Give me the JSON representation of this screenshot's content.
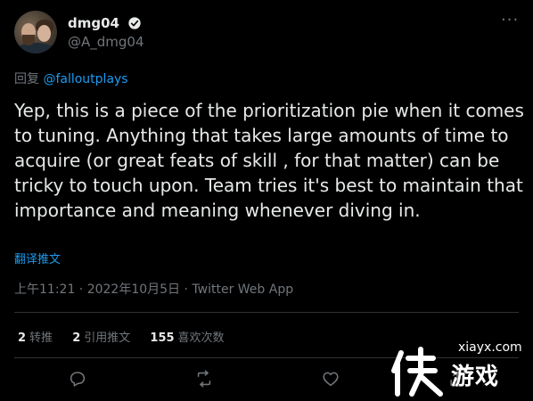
{
  "author": {
    "display_name": "dmg04",
    "handle": "@A_dmg04"
  },
  "more_glyph": "···",
  "reply": {
    "prefix": "回复 ",
    "mention": "@falloutplays"
  },
  "tweet": {
    "text": "Yep, this is a piece of the prioritization pie when it comes to tuning. Anything that takes large amounts of time to acquire (or great feats of skill , for that matter) can be tricky to touch upon. Team tries it's best to maintain that importance and meaning whenever diving in.",
    "translate_label": "翻译推文",
    "meta": "上午11:21 · 2022年10月5日 · Twitter Web App"
  },
  "stats": {
    "retweets_count": "2",
    "retweets_label": "转推",
    "quotes_count": "2",
    "quotes_label": "引用推文",
    "likes_count": "155",
    "likes_label": "喜欢次数"
  },
  "actions": [
    "reply-icon",
    "retweet-icon",
    "like-icon",
    "share-icon"
  ],
  "watermark": {
    "site": "xiayx.com",
    "text": "游戏"
  },
  "colors": {
    "background": "#000000",
    "text": "#e7e9ea",
    "secondary": "#71767b",
    "accent": "#1d9bf0",
    "divider": "#2f3336"
  }
}
